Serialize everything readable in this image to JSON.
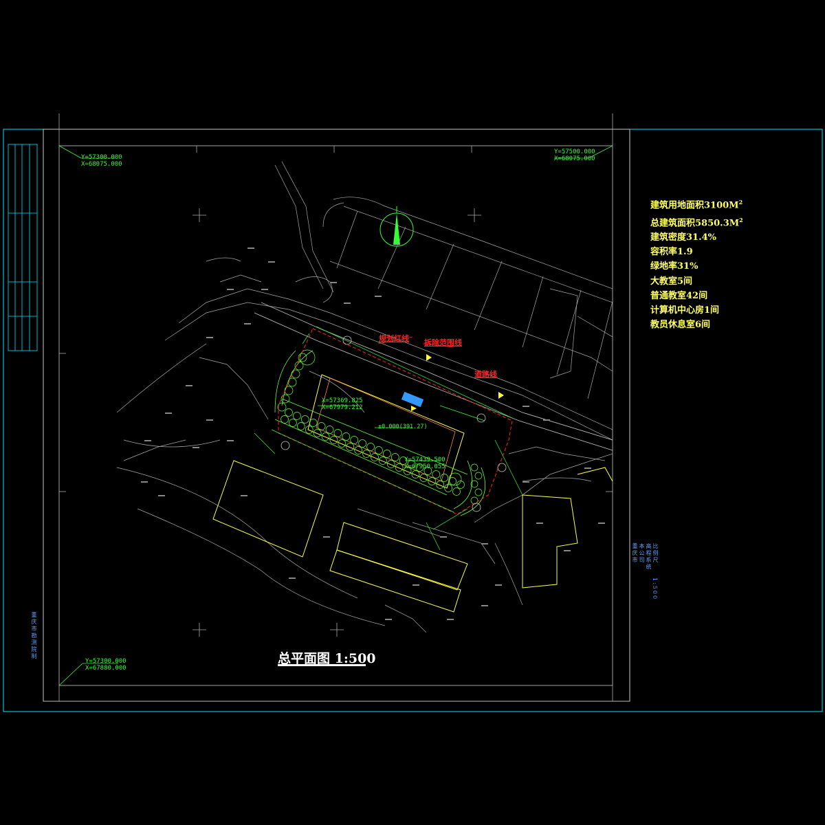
{
  "drawing": {
    "title": "总平面图 1:500",
    "stats": [
      {
        "text": "建筑用地面积3100M",
        "sup": "2"
      },
      {
        "text": "总建筑面积5850.3M",
        "sup": "2"
      },
      {
        "text": "建筑密度31.4%",
        "sup": ""
      },
      {
        "text": "容积率1.9",
        "sup": ""
      },
      {
        "text": "绿地率31%",
        "sup": ""
      },
      {
        "text": "大教室5间",
        "sup": ""
      },
      {
        "text": "普通教室42间",
        "sup": ""
      },
      {
        "text": "计算机中心房1间",
        "sup": ""
      },
      {
        "text": "教员休息室6间",
        "sup": ""
      }
    ],
    "coordinates": {
      "top_left": {
        "y": "Y=57300.000",
        "x": "X=68075.000"
      },
      "top_right": {
        "y": "Y=57500.000",
        "x": "X=68075.000"
      },
      "bottom_left": {
        "y": "Y=57300.000",
        "x": "X=67880.000"
      },
      "building_nw": {
        "y": "X=57369.825",
        "x": "X=67979.212"
      },
      "building_se": {
        "y": "Y=57439.500",
        "x": "X=67950.055"
      }
    },
    "labels": {
      "red_line_1": "规划红线",
      "red_line_2": "拆除范围线",
      "red_line_3": "道路线",
      "elevation": "±0.000(391.27)",
      "side_note_left": "重庆市勘测院制",
      "side_note_right_1": "重庆市",
      "side_note_right_2": "本公司",
      "side_note_right_3": "高程系统",
      "side_note_right_4": "比例尺",
      "side_note_right_5": "1:500"
    },
    "colors": {
      "frame": "#00e5ff",
      "inner_frame": "#cccccc",
      "stats_text": "#ffff66",
      "red_line": "#ff2222",
      "green_coord": "#33ff33",
      "building": "#ffff44",
      "trees": "#66ff33"
    }
  }
}
